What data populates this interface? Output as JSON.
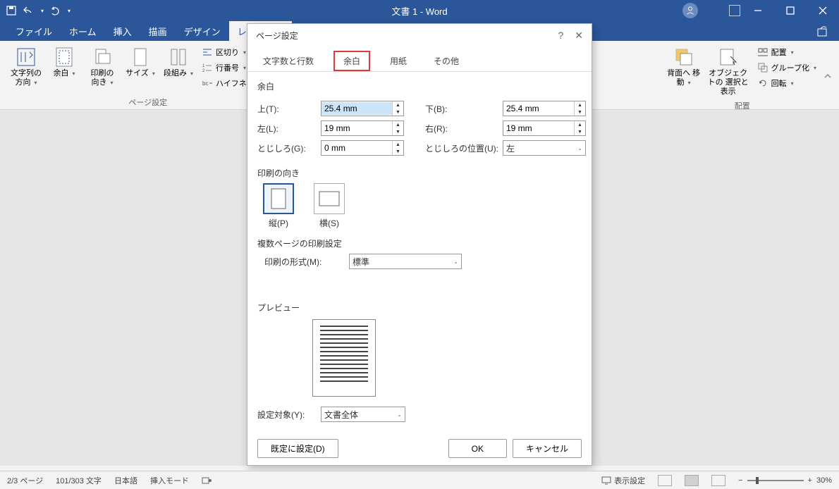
{
  "titlebar": {
    "title": "文書 1  -  Word"
  },
  "tabs": {
    "file": "ファイル",
    "home": "ホーム",
    "insert": "挿入",
    "draw": "描画",
    "design": "デザイン",
    "layout": "レイアウト"
  },
  "ribbon": {
    "text_direction": "文字列の\n方向",
    "margins": "余白",
    "orientation": "印刷の\n向き",
    "size": "サイズ",
    "columns": "段組み",
    "breaks": "区切り",
    "line_numbers": "行番号",
    "hyphenation": "ハイフネーション",
    "group_page_setup": "ページ設定",
    "send_backward": "背面へ\n移動",
    "selection_pane": "オブジェクトの\n選択と表示",
    "align_menu": "配置",
    "group_menu": "グループ化",
    "rotate_menu": "回転",
    "group_arrange": "配置"
  },
  "dialog": {
    "title": "ページ設定",
    "tabs": {
      "chars_lines": "文字数と行数",
      "margins": "余白",
      "paper": "用紙",
      "other": "その他"
    },
    "section_margins": "余白",
    "labels": {
      "top": "上(T):",
      "bottom": "下(B):",
      "left": "左(L):",
      "right": "右(R):",
      "gutter": "とじしろ(G):",
      "gutter_pos": "とじしろの位置(U):"
    },
    "values": {
      "top": "25.4 mm",
      "bottom": "25.4 mm",
      "left": "19 mm",
      "right": "19 mm",
      "gutter": "0 mm",
      "gutter_pos": "左"
    },
    "section_orientation": "印刷の向き",
    "orientation_portrait": "縦(P)",
    "orientation_landscape": "横(S)",
    "section_multi": "複数ページの印刷設定",
    "multi_label": "印刷の形式(M):",
    "multi_value": "標準",
    "section_preview": "プレビュー",
    "apply_to_label": "設定対象(Y):",
    "apply_to_value": "文書全体",
    "btn_default": "既定に設定(D)",
    "btn_ok": "OK",
    "btn_cancel": "キャンセル"
  },
  "statusbar": {
    "page": "2/3 ページ",
    "words": "101/303 文字",
    "language": "日本語",
    "insert_mode": "挿入モード",
    "display_settings": "表示設定",
    "zoom": "30%"
  }
}
